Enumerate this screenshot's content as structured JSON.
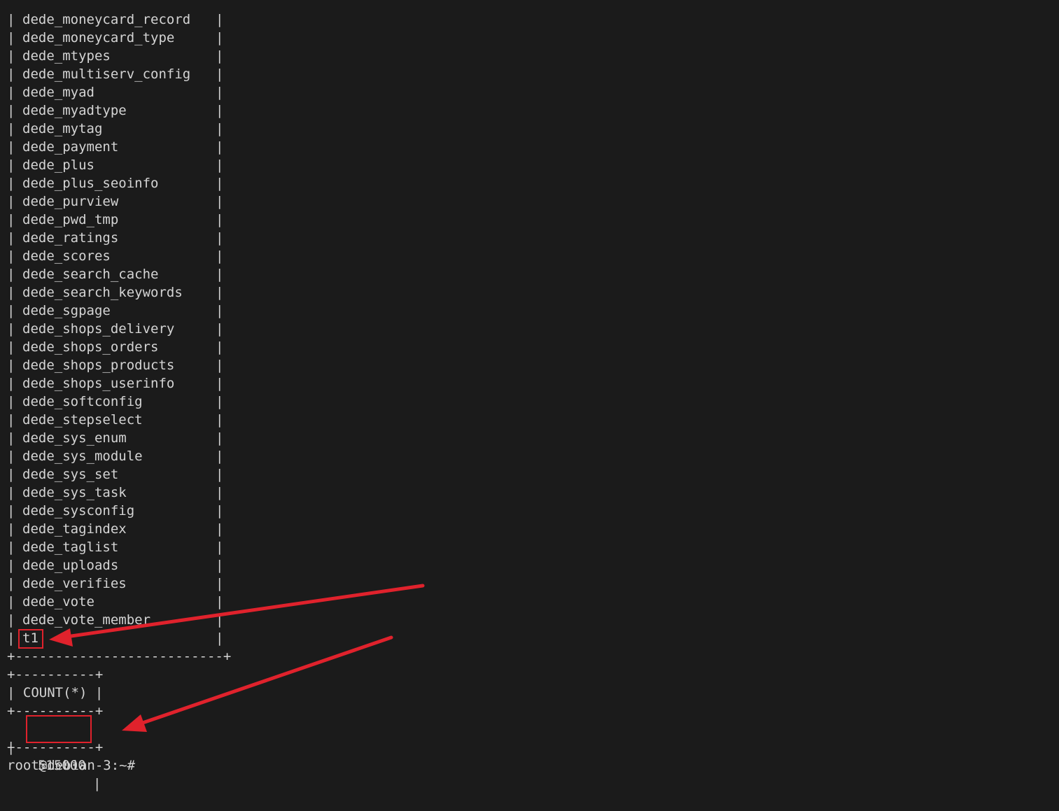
{
  "terminal": {
    "table_rows": [
      "dede_moneycard_record",
      "dede_moneycard_type",
      "dede_mtypes",
      "dede_multiserv_config",
      "dede_myad",
      "dede_myadtype",
      "dede_mytag",
      "dede_payment",
      "dede_plus",
      "dede_plus_seoinfo",
      "dede_purview",
      "dede_pwd_tmp",
      "dede_ratings",
      "dede_scores",
      "dede_search_cache",
      "dede_search_keywords",
      "dede_sgpage",
      "dede_shops_delivery",
      "dede_shops_orders",
      "dede_shops_products",
      "dede_shops_userinfo",
      "dede_softconfig",
      "dede_stepselect",
      "dede_sys_enum",
      "dede_sys_module",
      "dede_sys_set",
      "dede_sys_task",
      "dede_sysconfig",
      "dede_tagindex",
      "dede_taglist",
      "dede_uploads",
      "dede_verifies",
      "dede_vote",
      "dede_vote_member",
      "t1"
    ],
    "table_border": "+--------------------------+",
    "count_border": "+----------+",
    "count_header": "| COUNT(*) |",
    "count_value": "515000",
    "prompt": "root@debian-3:~#"
  },
  "colors": {
    "background": "#1b1b1b",
    "text": "#d4d4d4",
    "annotation": "#e0222c"
  }
}
